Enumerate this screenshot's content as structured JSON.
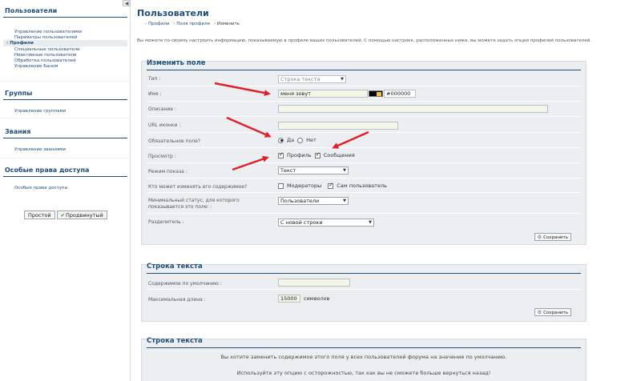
{
  "sidebar": {
    "users": {
      "title": "Пользователи",
      "items": [
        "Управление пользователями",
        "Параметры пользователей",
        "Профили",
        "Специальные пользователи",
        "Неактивные пользователи",
        "Обработка пользователей",
        "Управление Баном"
      ]
    },
    "groups": {
      "title": "Группы",
      "items": [
        "Управление группами"
      ]
    },
    "ranks": {
      "title": "Звания",
      "items": [
        "Управление званиями"
      ]
    },
    "perms": {
      "title": "Особые права доступа",
      "items": [
        "Особые права доступа"
      ]
    },
    "btn_simple": "Простой",
    "btn_advanced": "Продвинутый"
  },
  "main": {
    "title": "Пользователи",
    "breadcrumb": [
      "Профили",
      "Поля профиля",
      "Изменить"
    ],
    "intro": "Вы можете по-своему настроить информацию, показываемую в профиле ваших пользователей. С помощью настроек, расположенных ниже, вы можете задать опции профилей пользователей."
  },
  "edit_panel": {
    "title": "Изменить поле",
    "type_label": "Тип :",
    "type_value": "Строка текста",
    "name_label": "Имя :",
    "name_value": "меня зовут",
    "color_value": "#000000",
    "desc_label": "Описание :",
    "icon_label": "URL иконки :",
    "required_label": "Обязательное поле?",
    "yes": "Да",
    "no": "Нет",
    "view_label": "Просмотр :",
    "view_profile": "Профиль",
    "view_messages": "Сообщения",
    "display_label": "Режим показа :",
    "display_value": "Текст",
    "who_label": "Кто может изменять его содержимое?",
    "who_mods": "Модераторы",
    "who_self": "Сам пользователь",
    "min_status_label": "Минимальный статус, для которого показывается это поле: :",
    "min_status_value": "Пользователи",
    "separator_label": "Разделитель :",
    "separator_value": "С новой строки",
    "save": "Сохранить"
  },
  "text_panel": {
    "title": "Строка текста",
    "default_label": "Содержимое по умолчанию :",
    "maxlen_label": "Максимальная длина :",
    "maxlen_value": "15000",
    "maxlen_unit": "символов",
    "save": "Сохранить"
  },
  "reset_panel": {
    "title": "Строка текста",
    "question": "Вы хотите заменить содержимое этого поля у всех пользователей форума на значение по умолчанию.",
    "warning": "Используйте эту опцию с осторожностью, так как вы не сможете больше вернуться назад!"
  },
  "colors": {
    "accent": "#1f4e79",
    "arrow": "#e0202a",
    "panel": "#eceff1"
  }
}
